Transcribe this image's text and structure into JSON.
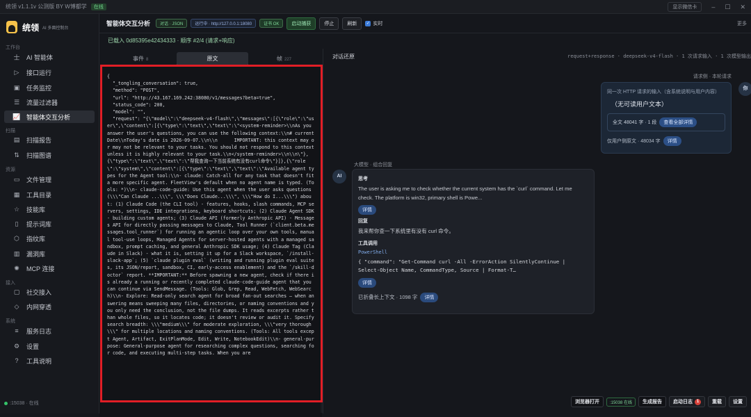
{
  "titlebar": {
    "app": "统领 v1.1.1v 公测版 BY W博都学",
    "badge": "在线",
    "show_btn": "显示微信卡",
    "min": "–",
    "max": "☐",
    "close": "✕"
  },
  "brand": {
    "name": "统领",
    "sub": "AI 多面控制台"
  },
  "sidebar": {
    "sections": {
      "workbench": "工作台",
      "scan": "扫描",
      "resources": "资源",
      "access": "接入",
      "system": "系统"
    },
    "items": [
      {
        "icon": "士",
        "label": "AI 智能体"
      },
      {
        "icon": "▷",
        "label": "接口运行"
      },
      {
        "icon": "▣",
        "label": "任务监控"
      },
      {
        "icon": "☰",
        "label": "流量过滤器"
      },
      {
        "icon": "📈",
        "label": "智能体交互分析"
      },
      {
        "icon": "▤",
        "label": "扫描报告"
      },
      {
        "icon": "⇅",
        "label": "扫描图谱"
      },
      {
        "icon": "▭",
        "label": "文件管理"
      },
      {
        "icon": "▦",
        "label": "工具目录"
      },
      {
        "icon": "☆",
        "label": "技能库"
      },
      {
        "icon": "▯",
        "label": "提示词库"
      },
      {
        "icon": "⬡",
        "label": "指纹库"
      },
      {
        "icon": "▥",
        "label": "漏洞库"
      },
      {
        "icon": "✺",
        "label": "MCP 连接"
      },
      {
        "icon": "▢",
        "label": "社交接入"
      },
      {
        "icon": "◇",
        "label": "内网穿透"
      },
      {
        "icon": "≡",
        "label": "服务日志"
      },
      {
        "icon": "⚙",
        "label": "设置"
      },
      {
        "icon": "?",
        "label": "工具说明"
      }
    ],
    "footer": ":15038 · 在线"
  },
  "topbar": {
    "title": "智能体交互分析",
    "pill1": "对话 · JSON",
    "pill2": "运行中 · http://127.0.0.1:18080",
    "pill3": "证书 OK",
    "btn_start": "启动捕获",
    "btn_stop": "停止",
    "btn_refresh": "刷新",
    "realtime": "实时",
    "more": "更多"
  },
  "status": "已载入 0d85395e42434333 · 顺序 #2/4 (请求+响应)",
  "tabs": [
    {
      "label": "事件",
      "count": "8"
    },
    {
      "label": "原文",
      "count": ""
    },
    {
      "label": "帧",
      "count": "227"
    }
  ],
  "raw_text": "{\n  \"_tongling_conversation\": true,\n  \"method\": \"POST\",\n  \"url\": \"http://43.167.169.242:38080/v1/messages?beta=true\",\n  \"status_code\": 200,\n  \"model\": \"\",\n  \"request\": \"{\\\"model\\\":\\\"deepseek-v4-flash\\\",\\\"messages\\\":[{\\\"role\\\":\\\"user\\\",\\\"content\\\":[{\\\"type\\\":\\\"text\\\",\\\"text\\\":\\\"<system-reminder>\\\\nAs you answer the user's questions, you can use the following context:\\\\n# currentDate\\\\nToday's date is 2026-09-07.\\\\n\\\\n      IMPORTANT: this context may or may not be relevant to your tasks. You should not respond to this context unless it is highly relevant to your task.\\\\n</system-reminder>\\\\n\\\\n\\\"},{\\\"type\\\":\\\"text\\\",\\\"text\\\":\\\"帮我查询一下当前系统有没有curl命令\\\"}]},{\\\"role\\\":\\\"system\\\",\\\"content\\\":[{\\\"type\\\":\\\"text\\\",\\\"text\\\":\\\"Available agent types for the Agent tool:\\\\n- claude: Catch-all for any task that doesn't fit a more specific agent. FleetView's default when no agent name is typed. (Tools: *)\\\\n- claude-code-guide: Use this agent when the user asks questions (\\\\\\\"Can Claude ...\\\\\\\", \\\\\\\"Does Claude...\\\\\\\", \\\\\\\"How do I...\\\\\\\") about: (1) Claude Code (the CLI tool) - features, hooks, slash commands, MCP servers, settings, IDE integrations, keyboard shortcuts; (2) Claude Agent SDK - building custom agents; (3) Claude API (formerly Anthropic API) - Messages API for directly passing messages to Claude, Tool Runner (`client.beta.messages.tool_runner`) for running an agentic loop over your own tools, manual tool-use loops, Managed Agents for server-hosted agents with a managed sandbox, prompt caching, and general Anthropic SDK usage; (4) Claude Tag (Claude in Slack) - what it is, setting it up for a Slack workspace, `/install-slack-app`; (5) `claude plugin eval` (writing and running plugin eval suites, its JSON/report, sandbox, CI, early-access enablement) and the `/skill-doctor` report. **IMPORTANT:** Before spawning a new agent, check if there is already a running or recently completed claude-code-guide agent that you can continue via SendMessage. (Tools: Glob, Grep, Read, WebFetch, WebSearch)\\\\n- Explore: Read-only search agent for broad fan-out searches — when answering means sweeping many files, directories, or naming conventions and you only need the conclusion, not the file dumps. It reads excerpts rather than whole files, so it locates code; it doesn't review or audit it. Specify search breadth: \\\\\\\"medium\\\\\\\" for moderate exploration, \\\\\\\"very thorough\\\\\\\" for multiple locations and naming conventions. (Tools: All tools except Agent, Artifact, ExitPlanMode, Edit, Write, NotebookEdit)\\\\n- general-purpose: General-purpose agent for researching complex questions, searching for code, and executing multi-step tasks. When you are",
  "conversation": {
    "title": "对话还原",
    "meta": "request+response · deepseek-v4-flash · 1 次请求输入 · 1 次模型输出",
    "req_label": "请求侧 · 本轮请求",
    "req_avatar": "你",
    "req_t1": "同一次 HTTP 请求的输入（含系统说明与用户内容）",
    "req_t2": "（无可读用户文本）",
    "req_full": "全文 48041 字 · 1 段",
    "req_full_btn": "查看全部详情",
    "req_user_only": "仅用户侧原文 · 48034 字",
    "req_detail_btn": "详情",
    "ai_avatar": "AI",
    "ai_label": "大模型 · 组合回复",
    "think_h": "思考",
    "think_p": "The user is asking me to check whether the current system has the `curl` command. Let me check. The platform is win32, primary shell is Powe...",
    "detail": "详情",
    "answer_h": "回复",
    "answer_p": "我来帮你查一下系统里有没有 curl 命令。",
    "tool_h": "工具调用",
    "tool_name": "PowerShell",
    "tool_code": "{ \"command\": \"Get-Command curl -All -ErrorAction SilentlyContinue | Select-Object Name, CommandType, Source | Format-T…",
    "fold": "已折叠长上下文 · 1098 字"
  },
  "bottombar": {
    "open": "浏览器打开",
    "port": ":15038 在线",
    "report": "生成报告",
    "log": "启动日志",
    "log_count": "1",
    "reset": "重载",
    "settings": "设置"
  }
}
